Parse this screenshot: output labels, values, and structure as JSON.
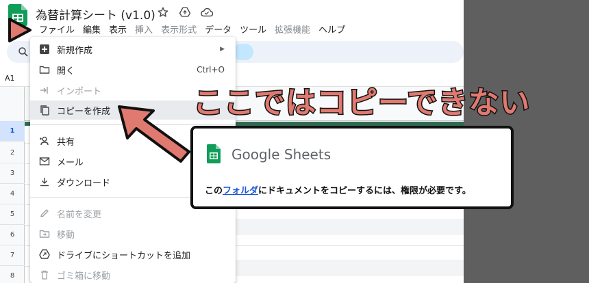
{
  "header": {
    "title": "為替計算シート (v1.0)",
    "icons": [
      "star-icon",
      "move-to-drive-icon",
      "cloud-status-icon"
    ]
  },
  "menubar": {
    "items": [
      {
        "label": "ファイル",
        "state": "active"
      },
      {
        "label": "編集",
        "state": "normal"
      },
      {
        "label": "表示",
        "state": "normal"
      },
      {
        "label": "挿入",
        "state": "disabled"
      },
      {
        "label": "表示形式",
        "state": "disabled"
      },
      {
        "label": "データ",
        "state": "normal"
      },
      {
        "label": "ツール",
        "state": "normal"
      },
      {
        "label": "拡張機能",
        "state": "disabled"
      },
      {
        "label": "ヘルプ",
        "state": "normal"
      }
    ]
  },
  "namebox": {
    "value": "A1"
  },
  "grid": {
    "rows": [
      "1",
      "2",
      "3",
      "4",
      "5",
      "6",
      "7",
      "8"
    ],
    "selected_row": "1"
  },
  "file_menu": {
    "items": [
      {
        "label": "新規作成",
        "icon": "add-box-icon",
        "submenu": true
      },
      {
        "label": "開く",
        "icon": "folder-icon",
        "shortcut": "Ctrl+O"
      },
      {
        "label": "インポート",
        "icon": "import-icon",
        "disabled": true
      },
      {
        "label": "コピーを作成",
        "icon": "copy-icon",
        "highlighted": true
      },
      {
        "label": "共有",
        "icon": "person-add-icon"
      },
      {
        "label": "メール",
        "icon": "mail-icon"
      },
      {
        "label": "ダウンロード",
        "icon": "download-icon"
      },
      {
        "label": "名前を変更",
        "icon": "pencil-icon",
        "disabled": true
      },
      {
        "label": "移動",
        "icon": "move-folder-icon",
        "disabled": true
      },
      {
        "label": "ドライブにショートカットを追加",
        "icon": "drive-shortcut-icon"
      },
      {
        "label": "ゴミ箱に移動",
        "icon": "trash-icon",
        "disabled": true
      }
    ]
  },
  "annotation": {
    "text": "ここではコピーできない",
    "color": "#e0796f"
  },
  "dialog": {
    "brand": "Google Sheets",
    "message_before": "この",
    "message_link": "フォルダ",
    "message_after": "にドキュメントをコピーするには、権限が必要です。",
    "link_color": "#1a56d6"
  },
  "colors": {
    "sheets_green": "#0f9d58",
    "highlight_row": "#e8eaed",
    "toolbar_bg": "#edf2fa",
    "side_panel": "#5f5f5f"
  }
}
